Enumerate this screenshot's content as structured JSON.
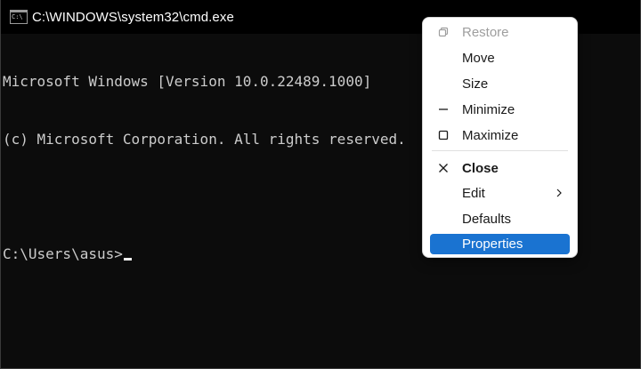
{
  "window": {
    "title": "C:\\WINDOWS\\system32\\cmd.exe",
    "icon_label": "C:\\"
  },
  "console": {
    "lines": [
      "Microsoft Windows [Version 10.0.22489.1000]",
      "(c) Microsoft Corporation. All rights reserved.",
      "",
      "C:\\Users\\asus>"
    ]
  },
  "context_menu": {
    "items": [
      {
        "label": "Restore",
        "icon": "restore-icon",
        "state": "disabled"
      },
      {
        "label": "Move",
        "icon": "",
        "state": "normal"
      },
      {
        "label": "Size",
        "icon": "",
        "state": "normal"
      },
      {
        "label": "Minimize",
        "icon": "minimize-icon",
        "state": "normal"
      },
      {
        "label": "Maximize",
        "icon": "maximize-icon",
        "state": "normal"
      },
      {
        "label": "Close",
        "icon": "close-icon",
        "state": "bold"
      },
      {
        "label": "Edit",
        "icon": "chevron-right-icon",
        "state": "submenu"
      },
      {
        "label": "Defaults",
        "icon": "",
        "state": "normal"
      },
      {
        "label": "Properties",
        "icon": "",
        "state": "selected"
      }
    ]
  },
  "colors": {
    "console_bg": "#0c0c0c",
    "console_text": "#cccccc",
    "titlebar_bg": "#000000",
    "menu_bg": "#ffffff",
    "menu_selected": "#1a73d1",
    "menu_disabled_text": "#9e9e9e"
  }
}
